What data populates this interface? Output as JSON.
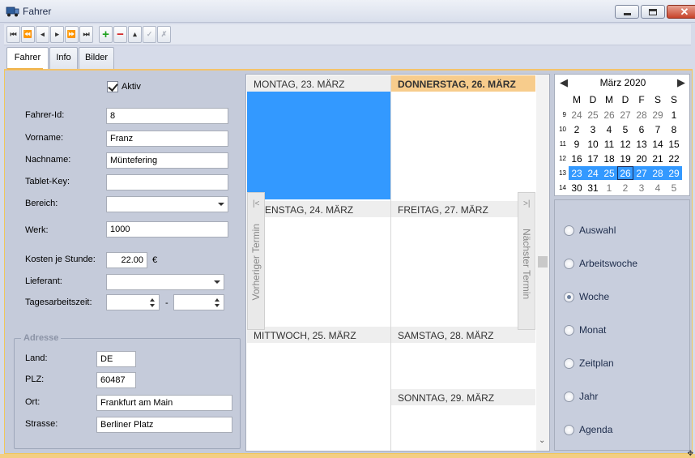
{
  "window": {
    "title": "Fahrer",
    "icon": "truck-icon",
    "controls": [
      "minimize-icon",
      "maximize-icon",
      "close-icon"
    ]
  },
  "toolbar": {
    "buttons": [
      {
        "name": "first-record-button",
        "glyph": "⏮"
      },
      {
        "name": "prev-page-button",
        "glyph": "⏪"
      },
      {
        "name": "prev-record-button",
        "glyph": "◂"
      },
      {
        "name": "next-record-button",
        "glyph": "▸"
      },
      {
        "name": "next-page-button",
        "glyph": "⏩"
      },
      {
        "name": "last-record-button",
        "glyph": "⏭"
      },
      {
        "name": "add-record-button",
        "glyph": "+"
      },
      {
        "name": "delete-record-button",
        "glyph": "−"
      },
      {
        "name": "edit-record-button",
        "glyph": "▴"
      },
      {
        "name": "post-record-button",
        "glyph": "✓"
      },
      {
        "name": "cancel-record-button",
        "glyph": "✗"
      }
    ]
  },
  "tabs": [
    {
      "label": "Fahrer",
      "active": true
    },
    {
      "label": "Info",
      "active": false
    },
    {
      "label": "Bilder",
      "active": false
    }
  ],
  "form": {
    "aktiv_label": "Aktiv",
    "aktiv_checked": true,
    "fahrer_id_label": "Fahrer-Id:",
    "fahrer_id": "8",
    "vorname_label": "Vorname:",
    "vorname": "Franz",
    "nachname_label": "Nachname:",
    "nachname": "Müntefering",
    "tablet_key_label": "Tablet-Key:",
    "tablet_key": "",
    "bereich_label": "Bereich:",
    "bereich": "",
    "werk_label": "Werk:",
    "werk": "1000",
    "kosten_label": "Kosten je Stunde:",
    "kosten": "22.00",
    "currency": "€",
    "lieferant_label": "Lieferant:",
    "lieferant": "",
    "tagesarbeitszeit_label": "Tagesarbeitszeit:",
    "tagesarbeitszeit_von": "",
    "tagesarbeitszeit_separator": "-",
    "tagesarbeitszeit_bis": ""
  },
  "address": {
    "title": "Adresse",
    "land_label": "Land:",
    "land": "DE",
    "plz_label": "PLZ:",
    "plz": "60487",
    "ort_label": "Ort:",
    "ort": "Frankfurt am Main",
    "strasse_label": "Strasse:",
    "strasse": "Berliner Platz"
  },
  "week_view": {
    "days": {
      "mon": "MONTAG, 23. MÄRZ",
      "tue": "ENSTAG, 24. MÄRZ",
      "wed": "MITTWOCH, 25. MÄRZ",
      "thu": "DONNERSTAG, 26. MÄRZ",
      "fri": "FREITAG, 27. MÄRZ",
      "sat": "SAMSTAG, 28. MÄRZ",
      "sun": "SONNTAG, 29. MÄRZ"
    },
    "prev_label": "Vorheriger Termin",
    "next_label": "Nächster Termin",
    "selected_color": "#3399ff",
    "today_color": "#f7cc8c"
  },
  "mini_calendar": {
    "month_label": "März 2020",
    "weekday_headers": [
      "M",
      "D",
      "M",
      "D",
      "F",
      "S",
      "S"
    ],
    "weeks": [
      {
        "wk": "9",
        "days": [
          "24",
          "25",
          "26",
          "27",
          "28",
          "29",
          "1"
        ]
      },
      {
        "wk": "10",
        "days": [
          "2",
          "3",
          "4",
          "5",
          "6",
          "7",
          "8"
        ]
      },
      {
        "wk": "11",
        "days": [
          "9",
          "10",
          "11",
          "12",
          "13",
          "14",
          "15"
        ]
      },
      {
        "wk": "12",
        "days": [
          "16",
          "17",
          "18",
          "19",
          "20",
          "21",
          "22"
        ]
      },
      {
        "wk": "13",
        "days": [
          "23",
          "24",
          "25",
          "26",
          "27",
          "28",
          "29"
        ]
      },
      {
        "wk": "14",
        "days": [
          "30",
          "31",
          "1",
          "2",
          "3",
          "4",
          "5"
        ]
      }
    ],
    "selected_week": "13",
    "today_day": "26"
  },
  "view_modes": {
    "options": [
      "Auswahl",
      "Arbeitswoche",
      "Woche",
      "Monat",
      "Zeitplan",
      "Jahr",
      "Agenda"
    ],
    "selected": "Woche"
  }
}
